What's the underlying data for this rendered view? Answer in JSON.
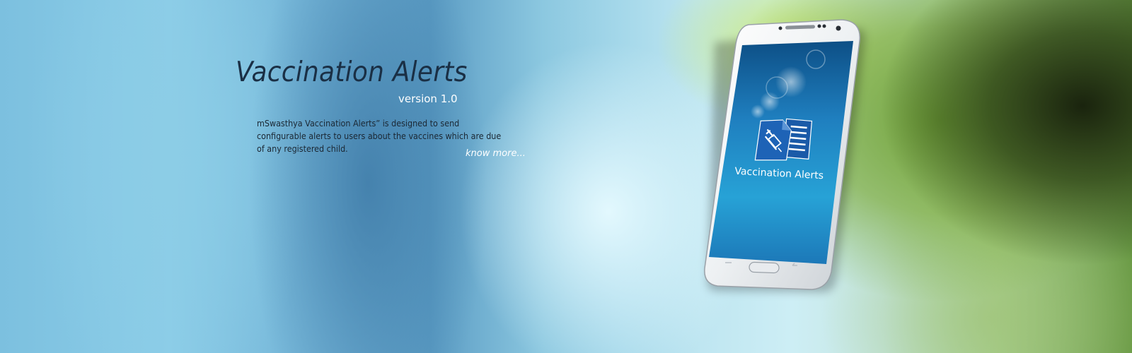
{
  "hero": {
    "title": "Vaccination Alerts",
    "version": "version  1.0",
    "description": "mSwasthya Vaccination Alerts” is designed to send configurable alerts to users about the vaccines which are due of any registered child.",
    "know_more": "know more...",
    "phone_screen_label": "Vaccination Alerts",
    "app_icon": "document-syringe-icon"
  },
  "colors": {
    "title": "#1a2f45",
    "screen_top": "#0d4f86",
    "screen_bottom": "#1f8fc9",
    "icon_blue": "#1a5aa8"
  }
}
